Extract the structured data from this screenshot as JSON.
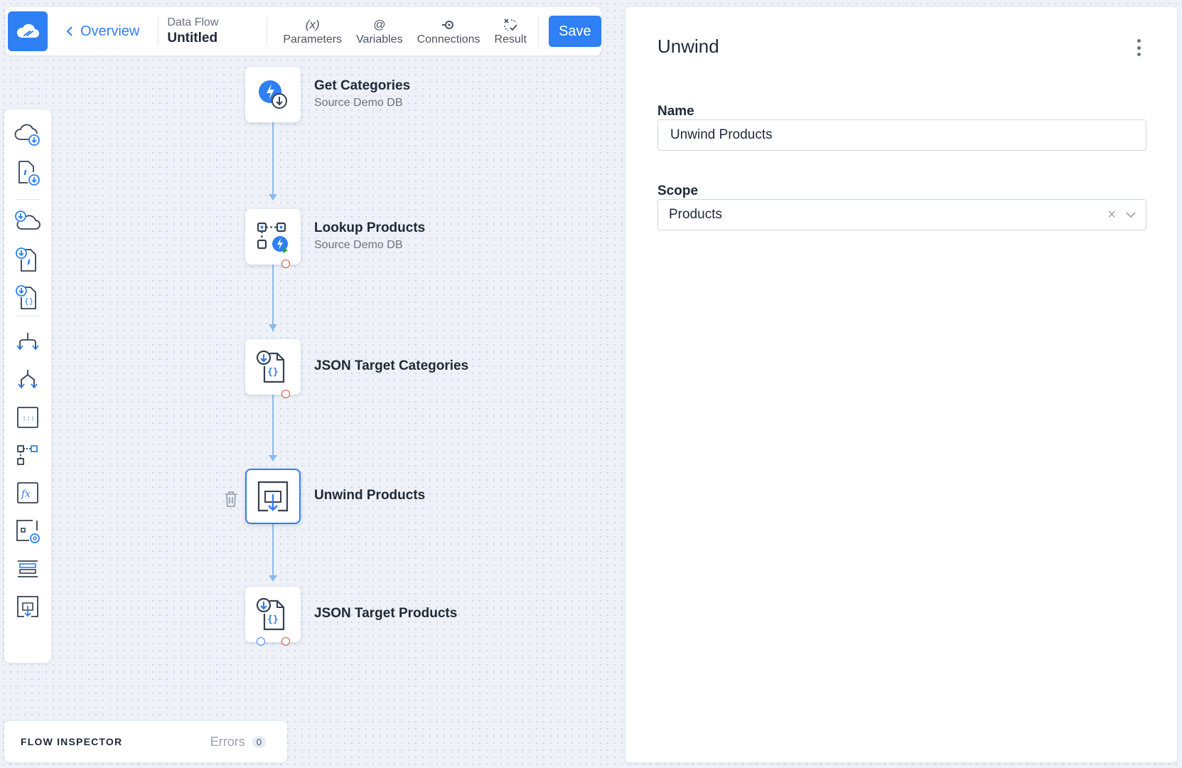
{
  "header": {
    "back_label": "Overview",
    "flow_type": "Data Flow",
    "flow_name": "Untitled",
    "tools": [
      {
        "label": "Parameters",
        "icon": "parameters-icon",
        "glyph": "(x)"
      },
      {
        "label": "Variables",
        "icon": "variables-icon",
        "glyph": "@"
      },
      {
        "label": "Connections",
        "icon": "connections-icon"
      },
      {
        "label": "Result",
        "icon": "result-icon"
      }
    ],
    "save_label": "Save"
  },
  "palette": {
    "items": [
      "cloud-source-icon",
      "csv-source-icon",
      "cloud-target-icon",
      "csv-target-icon",
      "json-target-icon",
      "split-icon",
      "merge-icon",
      "mapping-icon",
      "lookup-icon",
      "expression-icon",
      "variable-icon",
      "rows-icon",
      "unwind-icon"
    ]
  },
  "flow": {
    "nodes": [
      {
        "title": "Get Categories",
        "subtitle": "Source Demo DB"
      },
      {
        "title": "Lookup Products",
        "subtitle": "Source Demo DB"
      },
      {
        "title": "JSON Target Categories",
        "subtitle": ""
      },
      {
        "title": "Unwind Products",
        "subtitle": ""
      },
      {
        "title": "JSON Target Products",
        "subtitle": ""
      }
    ],
    "selected_node": "Unwind Products"
  },
  "inspector": {
    "title": "FLOW INSPECTOR",
    "errors_label": "Errors",
    "errors_count": "0"
  },
  "panel": {
    "title": "Unwind",
    "name_label": "Name",
    "name_value": "Unwind Products",
    "scope_label": "Scope",
    "scope_value": "Products",
    "clear_glyph": "×"
  },
  "colors": {
    "accent": "#2f7ff5",
    "connector": "#8db9ee",
    "error_port": "#e34a3c",
    "canvas": "#eef2f8"
  }
}
